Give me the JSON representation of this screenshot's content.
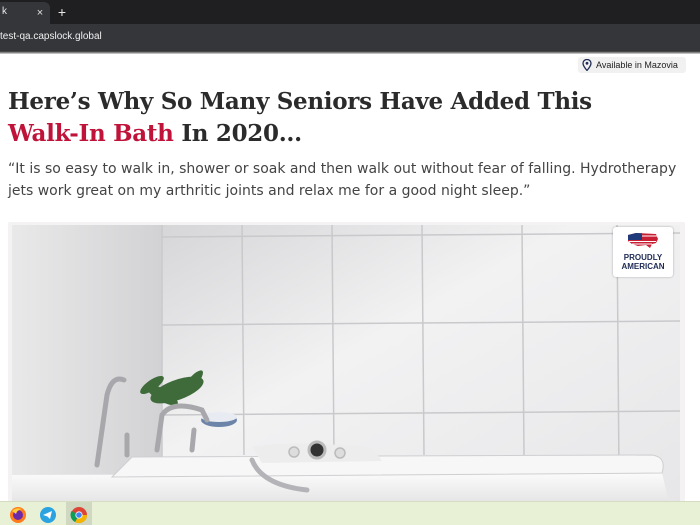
{
  "browser": {
    "tab_title": "k",
    "tab_close": "×",
    "new_tab": "+",
    "url": "test-qa.capslock.global"
  },
  "header": {
    "availability": "Available in Mazovia"
  },
  "headline": {
    "line1": "Here’s Why So Many Seniors Have Added This",
    "accent": "Walk-In Bath",
    "line2_rest": " In 2020..."
  },
  "quote": "“It is so easy to walk in, shower or soak and then walk out without fear of falling. Hydrotherapy jets work great on my arthritic joints and relax me for a good night sleep.”",
  "badge": {
    "text": "PROUDLY AMERICAN"
  },
  "colors": {
    "accent": "#c0133a",
    "headline": "#2b2b2b"
  },
  "taskbar": {
    "apps": [
      "firefox-icon",
      "telegram-icon",
      "chrome-icon"
    ]
  }
}
